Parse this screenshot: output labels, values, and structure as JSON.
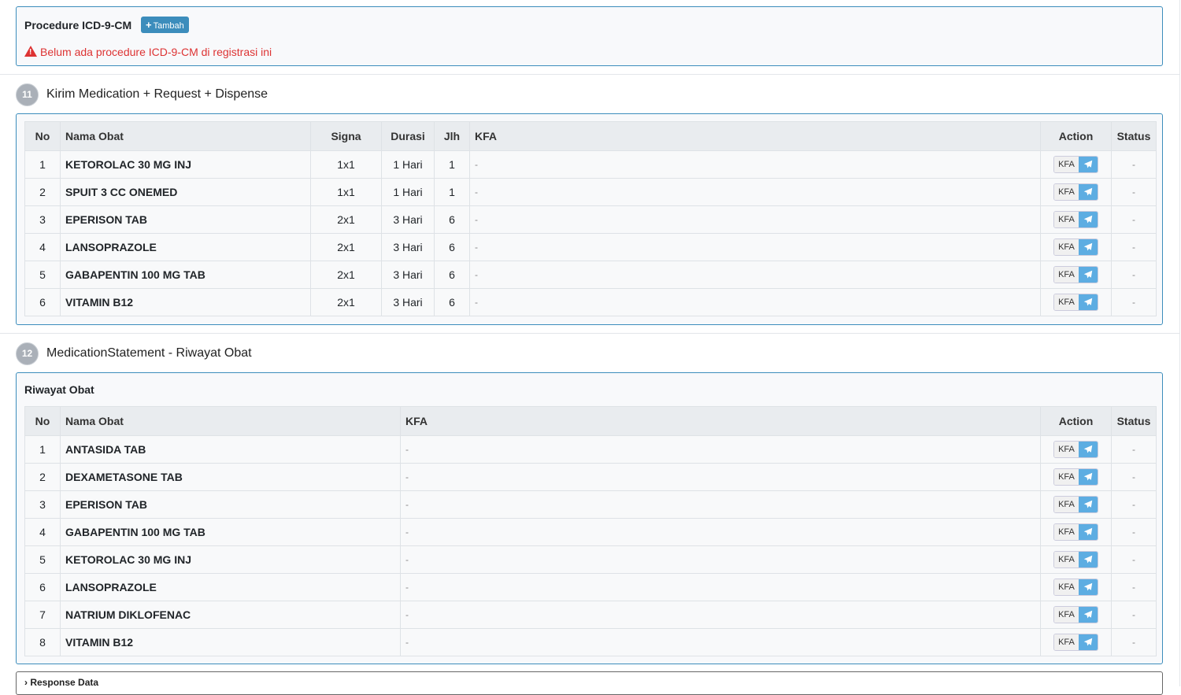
{
  "procedure": {
    "title": "Procedure ICD-9-CM",
    "add_label": "Tambah",
    "warning": "Belum ada procedure ICD-9-CM di registrasi ini"
  },
  "step11": {
    "number": "11",
    "label": "Kirim Medication + Request + Dispense",
    "headers": {
      "no": "No",
      "nama": "Nama Obat",
      "signa": "Signa",
      "durasi": "Durasi",
      "jlh": "Jlh",
      "kfa": "KFA",
      "action": "Action",
      "status": "Status"
    },
    "rows": [
      {
        "no": "1",
        "nama": "KETOROLAC 30 MG INJ",
        "signa": "1x1",
        "durasi": "1 Hari",
        "jlh": "1",
        "kfa": "-",
        "status": "-"
      },
      {
        "no": "2",
        "nama": "SPUIT 3 CC ONEMED",
        "signa": "1x1",
        "durasi": "1 Hari",
        "jlh": "1",
        "kfa": "-",
        "status": "-"
      },
      {
        "no": "3",
        "nama": "EPERISON TAB",
        "signa": "2x1",
        "durasi": "3 Hari",
        "jlh": "6",
        "kfa": "-",
        "status": "-"
      },
      {
        "no": "4",
        "nama": "LANSOPRAZOLE",
        "signa": "2x1",
        "durasi": "3 Hari",
        "jlh": "6",
        "kfa": "-",
        "status": "-"
      },
      {
        "no": "5",
        "nama": "GABAPENTIN 100 MG TAB",
        "signa": "2x1",
        "durasi": "3 Hari",
        "jlh": "6",
        "kfa": "-",
        "status": "-"
      },
      {
        "no": "6",
        "nama": "VITAMIN B12",
        "signa": "2x1",
        "durasi": "3 Hari",
        "jlh": "6",
        "kfa": "-",
        "status": "-"
      }
    ]
  },
  "step12": {
    "number": "12",
    "label": "MedicationStatement - Riwayat Obat",
    "card_title": "Riwayat Obat",
    "headers": {
      "no": "No",
      "nama": "Nama Obat",
      "kfa": "KFA",
      "action": "Action",
      "status": "Status"
    },
    "rows": [
      {
        "no": "1",
        "nama": "ANTASIDA TAB",
        "kfa": "-",
        "status": "-"
      },
      {
        "no": "2",
        "nama": "DEXAMETASONE TAB",
        "kfa": "-",
        "status": "-"
      },
      {
        "no": "3",
        "nama": "EPERISON TAB",
        "kfa": "-",
        "status": "-"
      },
      {
        "no": "4",
        "nama": "GABAPENTIN 100 MG TAB",
        "kfa": "-",
        "status": "-"
      },
      {
        "no": "5",
        "nama": "KETOROLAC 30 MG INJ",
        "kfa": "-",
        "status": "-"
      },
      {
        "no": "6",
        "nama": "LANSOPRAZOLE",
        "kfa": "-",
        "status": "-"
      },
      {
        "no": "7",
        "nama": "NATRIUM DIKLOFENAC",
        "kfa": "-",
        "status": "-"
      },
      {
        "no": "8",
        "nama": "VITAMIN B12",
        "kfa": "-",
        "status": "-"
      }
    ]
  },
  "kfa_button_label": "KFA",
  "response": {
    "label": "Response Data"
  },
  "colors": {
    "accent": "#3c8dbc",
    "danger": "#dd3333",
    "send": "#5dade2"
  },
  "icons": {
    "warning": "warning-triangle-icon",
    "send": "paper-plane-icon",
    "expand": "chevron-right-icon",
    "add": "plus-icon"
  }
}
